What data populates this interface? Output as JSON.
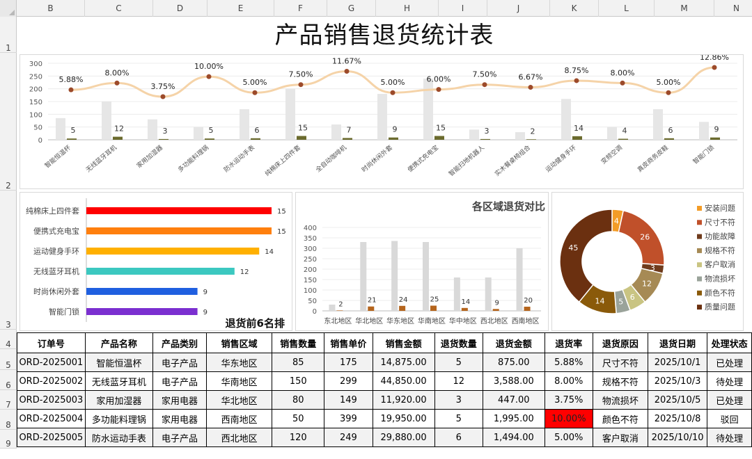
{
  "columns": [
    "B",
    "C",
    "D",
    "E",
    "F",
    "G",
    "H",
    "I",
    "J",
    "K",
    "L",
    "M",
    "N"
  ],
  "rows": [
    "1",
    "2",
    "3",
    "4",
    "5",
    "6",
    "7",
    "8",
    "9"
  ],
  "title": "产品销售退货统计表",
  "colors": {
    "sales_bar": "#e6e6e6",
    "return_bar": "#6b6b2e",
    "rate_line": "#f5d3a8",
    "rate_marker": "#9c4a2a",
    "region_sales": "#d9d9d9",
    "region_return": "#b5651d",
    "highlight": "#ff0000"
  },
  "table": {
    "headers": [
      "订单号",
      "产品名称",
      "产品类别",
      "销售区域",
      "销售数量",
      "销售单价",
      "销售金额",
      "退货数量",
      "退货金额",
      "退货率",
      "退货原因",
      "退货日期",
      "处理状态"
    ],
    "rows": [
      [
        "ORD-2025001",
        "智能恒温杯",
        "电子产品",
        "华东地区",
        "85",
        "175",
        "14,875.00",
        "5",
        "875.00",
        "5.88%",
        "尺寸不符",
        "2025/10/1",
        "已处理"
      ],
      [
        "ORD-2025002",
        "无线蓝牙耳机",
        "电子产品",
        "华南地区",
        "150",
        "299",
        "44,850.00",
        "12",
        "3,588.00",
        "8.00%",
        "规格不符",
        "2025/10/3",
        "待处理"
      ],
      [
        "ORD-2025003",
        "家用加湿器",
        "家用电器",
        "华北地区",
        "80",
        "149",
        "11,920.00",
        "3",
        "447.00",
        "3.75%",
        "物流损坏",
        "2025/10/5",
        "已处理"
      ],
      [
        "ORD-2025004",
        "多功能料理锅",
        "家用电器",
        "西南地区",
        "50",
        "399",
        "19,950.00",
        "5",
        "1,995.00",
        "10.00%",
        "颜色不符",
        "2025/10/8",
        "驳回"
      ],
      [
        "ORD-2025005",
        "防水运动手表",
        "电子产品",
        "西北地区",
        "120",
        "249",
        "29,880.00",
        "6",
        "1,494.00",
        "5.00%",
        "客户取消",
        "2025/10/10",
        "待处理"
      ]
    ],
    "highlight_cell": {
      "row": 3,
      "col": 9
    }
  },
  "chart_data": [
    {
      "type": "bar",
      "categories": [
        "智能恒温杯",
        "无线蓝牙耳机",
        "家用加湿器",
        "多功能料理锅",
        "防水运动手表",
        "纯棉床上四件套",
        "全自动咖啡机",
        "时尚休闲外套",
        "便携式充电宝",
        "智能扫地机器人",
        "实木餐桌椅组合",
        "运动健身手环",
        "变频空调",
        "真皮商务皮鞋",
        "智能门锁"
      ],
      "series": [
        {
          "values": [
            85,
            150,
            80,
            50,
            120,
            200,
            60,
            180,
            240,
            40,
            30,
            160,
            50,
            120,
            70
          ]
        },
        {
          "values": [
            5,
            12,
            3,
            5,
            6,
            15,
            7,
            9,
            15,
            3,
            2,
            14,
            4,
            6,
            9
          ]
        },
        {
          "values": [
            5.88,
            8.0,
            3.75,
            10.0,
            5.0,
            7.5,
            11.67,
            5.0,
            6.0,
            7.5,
            6.67,
            8.75,
            8.0,
            5.0,
            12.86
          ]
        }
      ],
      "rate_labels": [
        "5.88%",
        "8.00%",
        "3.75%",
        "10.00%",
        "5.00%",
        "7.50%",
        "11.67%",
        "5.00%",
        "6.00%",
        "7.50%",
        "6.67%",
        "8.75%",
        "8.00%",
        "5.00%",
        "12.86%"
      ],
      "yticks": [
        "0",
        "50",
        "100",
        "150",
        "200",
        "250",
        "300"
      ],
      "ylim": [
        0,
        300
      ]
    },
    {
      "type": "bar",
      "orientation": "horizontal",
      "title": "退货前6名排",
      "categories": [
        "纯棉床上四件套",
        "便携式充电宝",
        "运动健身手环",
        "无线蓝牙耳机",
        "时尚休闲外套",
        "智能门锁"
      ],
      "values": [
        15,
        15,
        14,
        12,
        9,
        9
      ],
      "colors": [
        "#ff0000",
        "#ff7f0e",
        "#ffb000",
        "#3cc8c0",
        "#1f5fe0",
        "#7b2fd0"
      ],
      "xlim": [
        0,
        15
      ]
    },
    {
      "type": "bar",
      "title": "各区域退货对比",
      "categories": [
        "东北地区",
        "华北地区",
        "华东地区",
        "华南地区",
        "华中地区",
        "西北地区",
        "西南地区"
      ],
      "series": [
        {
          "values": [
            30,
            330,
            335,
            330,
            160,
            160,
            300
          ]
        },
        {
          "values": [
            2,
            21,
            24,
            25,
            14,
            9,
            20
          ]
        }
      ],
      "yticks": [
        "0",
        "50",
        "100",
        "150",
        "200",
        "250",
        "300",
        "350",
        "400"
      ],
      "ylim": [
        0,
        400
      ]
    },
    {
      "type": "pie",
      "donut": true,
      "labels": [
        "安装问题",
        "尺寸不符",
        "功能故障",
        "规格不符",
        "客户取消",
        "物流损坏",
        "颜色不符",
        "质量问题"
      ],
      "values": [
        4,
        26,
        3,
        12,
        6,
        5,
        14,
        45
      ],
      "colors": [
        "#f39c27",
        "#c0502a",
        "#6f3b1c",
        "#a68a55",
        "#c9c482",
        "#9aa39a",
        "#8a5a0a",
        "#6b3010"
      ],
      "legend": "right"
    }
  ]
}
